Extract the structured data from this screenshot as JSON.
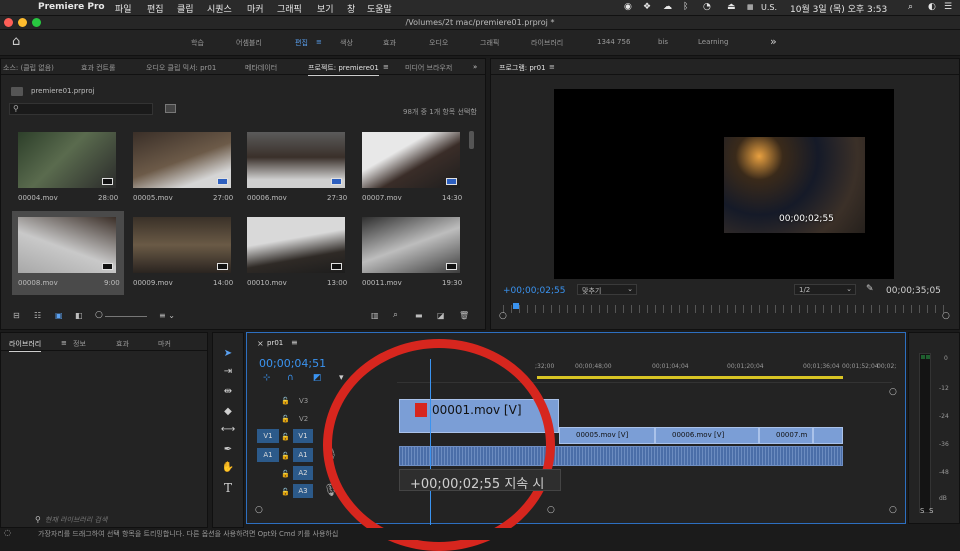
{
  "menubar": {
    "apple": "",
    "app": "Premiere Pro",
    "items": [
      "파일",
      "편집",
      "클립",
      "시퀀스",
      "마커",
      "그래픽",
      "보기",
      "창",
      "도움말"
    ],
    "lang": "U.S.",
    "datetime": "10월 3일 (목) 오후 3:53"
  },
  "titlebar": {
    "title": "/Volumes/2t mac/premiere01.prproj *"
  },
  "workspaces": {
    "items": [
      "학습",
      "어셈블리",
      "편집",
      "색상",
      "효과",
      "오디오",
      "그래픽",
      "라이브러리",
      "1344 756",
      "bis",
      "Learning"
    ],
    "active": "편집"
  },
  "source_panel": {
    "tabs": [
      "소스: (클립 없음)",
      "효과 컨트롤",
      "오디오 클립 믹서: pr01",
      "메타데이터",
      "프로젝트: premiere01",
      "미디어 브라우저"
    ],
    "active_tab": "프로젝트: premiere01",
    "project_file": "premiere01.prproj",
    "selection_status": "98개 중 1개 항목 선택함",
    "clips": [
      {
        "name": "00004.mov",
        "duration": "28:00"
      },
      {
        "name": "00005.mov",
        "duration": "27:00"
      },
      {
        "name": "00006.mov",
        "duration": "27:30"
      },
      {
        "name": "00007.mov",
        "duration": "14:30"
      },
      {
        "name": "00008.mov",
        "duration": "9:00"
      },
      {
        "name": "00009.mov",
        "duration": "14:00"
      },
      {
        "name": "00010.mov",
        "duration": "13:00"
      },
      {
        "name": "00011.mov",
        "duration": "19:30"
      }
    ]
  },
  "program_panel": {
    "title": "프로그램: pr01",
    "timecode": "+00;00;02;55",
    "fit": "맞추기",
    "resolution": "1/2",
    "duration": "00;00;35;05",
    "overlay_timecode": "00;00;02;55"
  },
  "library_panel": {
    "tabs": [
      "라이브러리",
      "정보",
      "효과",
      "마커"
    ],
    "search_placeholder": "현재 라이브러리 검색"
  },
  "timeline": {
    "sequence": "pr01",
    "timecode": "00;00;04;51",
    "ruler": [
      ";32;00",
      "00;00;48;00",
      "00;01;04;04",
      "00;01;20;04",
      "00;01;36;04",
      "00;01;52;04",
      "00;02;"
    ],
    "video_tracks": [
      "V3",
      "V2",
      "V1"
    ],
    "audio_tracks": [
      "A1",
      "A2",
      "A3"
    ],
    "source_v": "V1",
    "source_a": "A1",
    "clips": [
      "00001.mov [V]",
      "00005.mov [V]",
      "00006.mov [V]",
      "00007.m"
    ],
    "drag_tooltip": "+00;00;02;55 지속 시"
  },
  "meter": {
    "labels": [
      "0",
      "-12",
      "-24",
      "-36",
      "-48",
      "dB"
    ],
    "solo": [
      "S",
      "S"
    ]
  },
  "status": {
    "text": "가장자리를 드래그하여 선택 항목을 트리밍합니다. 다른 옵션을 사용하려면 Opt와 Cmd 키를 사용하십"
  },
  "colors": {
    "accent": "#2d8ceb",
    "annotation": "#d7261e",
    "clip_video": "#7b9ed6",
    "clip_audio": "#4b6ea8"
  }
}
